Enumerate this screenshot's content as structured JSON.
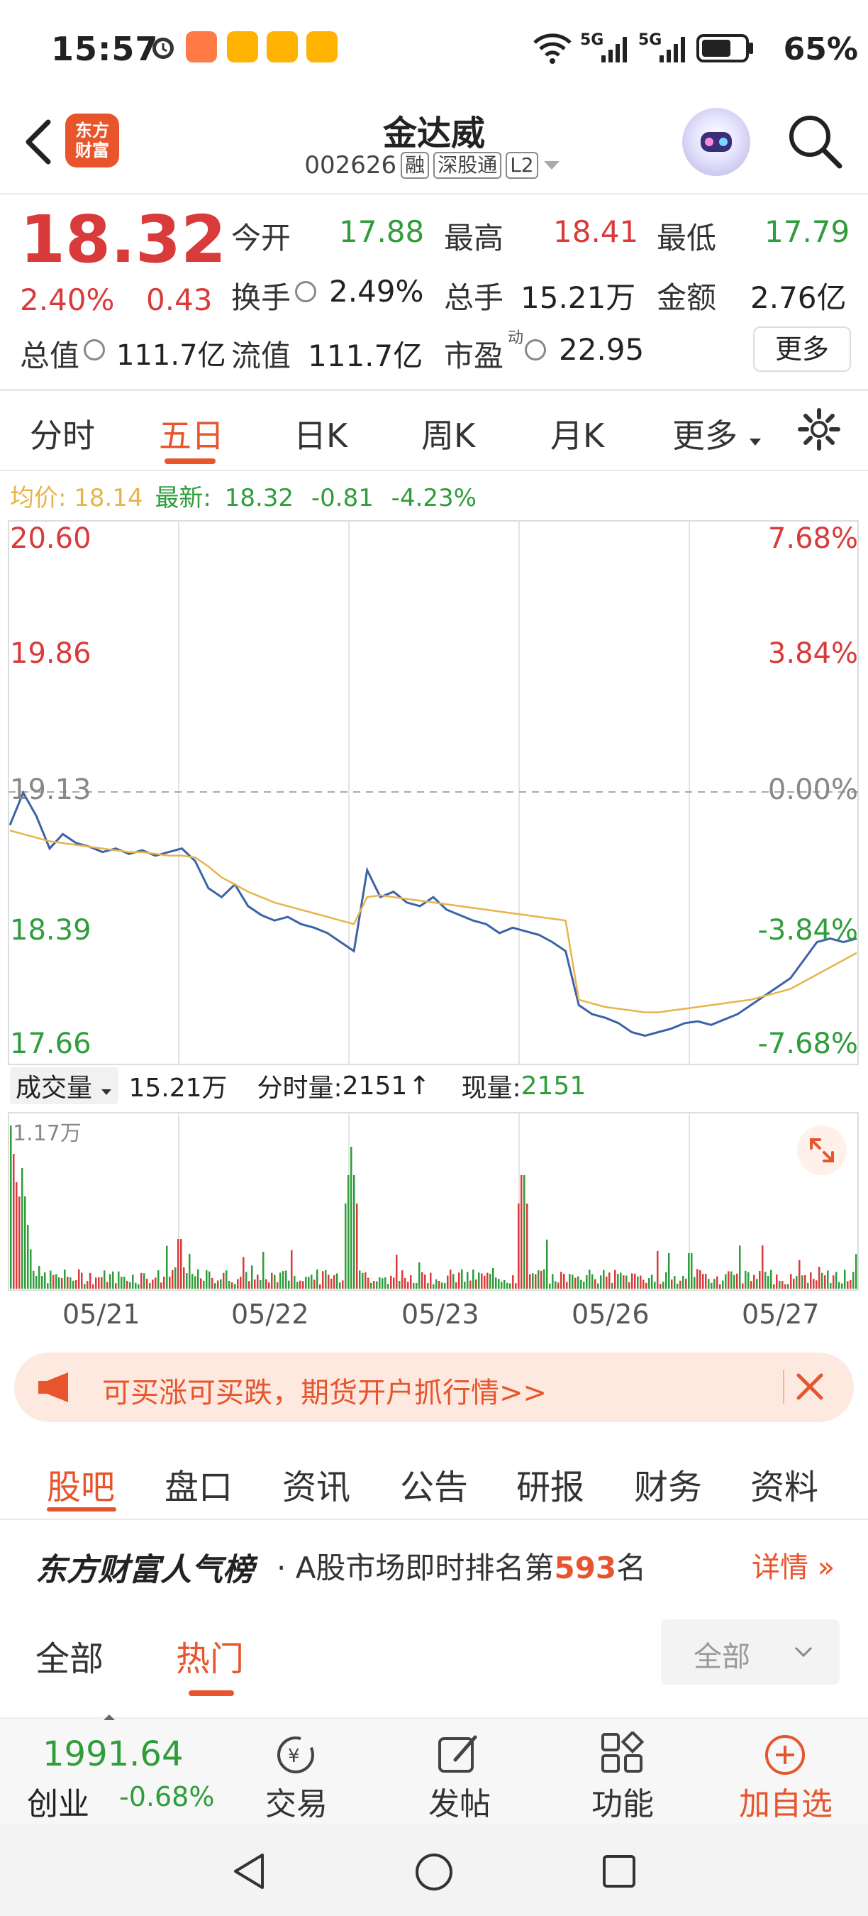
{
  "status_bar": {
    "time": "15:57",
    "battery": "65%",
    "signal_1": "5G",
    "signal_2": "5G",
    "wifi_label": "6"
  },
  "header": {
    "logo_text_1": "东方",
    "logo_text_2": "财富",
    "stock_name": "金达威",
    "stock_code": "002626",
    "tag_margin": "融",
    "tag_connect": "深股通",
    "tag_level": "L2"
  },
  "quote": {
    "price": "18.32",
    "change_pct": "2.40%",
    "change_amt": "0.43",
    "open_label": "今开",
    "open": "17.88",
    "high_label": "最高",
    "high": "18.41",
    "low_label": "最低",
    "low": "17.79",
    "turnover_label": "换手",
    "turnover": "2.49%",
    "volume_label": "总手",
    "volume": "15.21万",
    "amount_label": "金额",
    "amount": "2.76亿",
    "mktcap_label": "总值",
    "mktcap": "111.7亿",
    "float_label": "流值",
    "float_cap": "111.7亿",
    "pe_label": "市盈",
    "pe_sup": "动",
    "pe": "22.95",
    "more_label": "更多"
  },
  "chart_tabs": {
    "items": [
      "分时",
      "五日",
      "日K",
      "周K",
      "月K",
      "更多"
    ],
    "active": "五日"
  },
  "chart_legend": {
    "avg_label": "均价:",
    "avg": "18.14",
    "latest_label": "最新:",
    "latest": "18.32",
    "latest_chg": "-0.81",
    "latest_pct": "-4.23%"
  },
  "chart_data": {
    "type": "line",
    "title": "",
    "x": [
      "05/21",
      "05/22",
      "05/23",
      "05/26",
      "05/27"
    ],
    "y_ticks_price": [
      "20.60",
      "19.86",
      "19.13",
      "18.39",
      "17.66"
    ],
    "y_ticks_pct": [
      "7.68%",
      "3.84%",
      "0.00%",
      "-3.84%",
      "-7.68%"
    ],
    "ylim": [
      17.66,
      20.6
    ],
    "reference": 19.13,
    "grid": true,
    "series": [
      {
        "name": "",
        "color": "#3b63a8",
        "values": [
          18.95,
          19.13,
          19.0,
          18.82,
          18.9,
          18.85,
          18.83,
          18.8,
          18.82,
          18.79,
          18.81,
          18.78,
          18.8,
          18.82,
          18.75,
          18.6,
          18.55,
          18.62,
          18.5,
          18.45,
          18.42,
          18.44,
          18.4,
          18.38,
          18.35,
          18.3,
          18.25,
          18.7,
          18.55,
          18.58,
          18.52,
          18.5,
          18.55,
          18.48,
          18.45,
          18.42,
          18.4,
          18.35,
          18.38,
          18.36,
          18.34,
          18.3,
          18.25,
          17.95,
          17.9,
          17.88,
          17.85,
          17.8,
          17.78,
          17.8,
          17.82,
          17.85,
          17.86,
          17.84,
          17.87,
          17.9,
          17.95,
          18.0,
          18.05,
          18.1,
          18.2,
          18.3,
          18.32,
          18.3,
          18.32
        ]
      },
      {
        "name": "",
        "color": "#e8b44a",
        "values": [
          18.92,
          18.9,
          18.88,
          18.86,
          18.85,
          18.84,
          18.83,
          18.82,
          18.81,
          18.8,
          18.8,
          18.79,
          18.78,
          18.78,
          18.77,
          18.72,
          18.66,
          18.62,
          18.58,
          18.55,
          18.52,
          18.5,
          18.48,
          18.46,
          18.44,
          18.42,
          18.4,
          18.55,
          18.56,
          18.55,
          18.54,
          18.53,
          18.52,
          18.51,
          18.5,
          18.49,
          18.48,
          18.47,
          18.46,
          18.45,
          18.44,
          18.43,
          18.42,
          17.98,
          17.96,
          17.94,
          17.93,
          17.92,
          17.91,
          17.91,
          17.92,
          17.93,
          17.94,
          17.95,
          17.96,
          17.97,
          17.98,
          18.0,
          18.02,
          18.04,
          18.08,
          18.12,
          18.16,
          18.2,
          18.24
        ]
      }
    ]
  },
  "volume": {
    "select_label": "成交量",
    "total": "15.21万",
    "tick_label": "分时量:",
    "tick_value": "2151",
    "now_label": "现量:",
    "now_value": "2151",
    "max_label": "1.17万"
  },
  "promo": {
    "text": "可买涨可买跌，期货开户抓行情>>"
  },
  "content_tabs": {
    "items": [
      "股吧",
      "盘口",
      "资讯",
      "公告",
      "研报",
      "财务",
      "资料"
    ],
    "active": "股吧"
  },
  "popularity": {
    "title": "东方财富人气榜",
    "text_prefix": "· A股市场即时排名第",
    "rank": "593",
    "text_suffix": "名",
    "more": "详情"
  },
  "filter_tabs": {
    "items": [
      "全部",
      "热门"
    ],
    "active": "热门",
    "dropdown": "全部"
  },
  "bottom_bar": {
    "index_value": "1991.64",
    "index_name": "创业",
    "index_chg": "-0.68%",
    "trade": "交易",
    "post": "发帖",
    "functions": "功能",
    "add": "加自选"
  },
  "colors": {
    "up": "#d93a3a",
    "down": "#2e9d3a",
    "accent": "#e8542b",
    "price_line": "#3b63a8",
    "avg_line": "#e8b44a"
  }
}
